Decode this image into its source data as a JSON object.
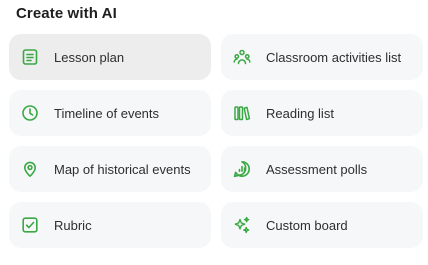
{
  "header": {
    "title": "Create with AI"
  },
  "accent_color": "#3aa845",
  "cards": [
    {
      "label": "Lesson plan",
      "icon": "document-lines-icon",
      "selected": true
    },
    {
      "label": "Classroom activities list",
      "icon": "people-group-icon",
      "selected": false
    },
    {
      "label": "Timeline of events",
      "icon": "clock-icon",
      "selected": false
    },
    {
      "label": "Reading list",
      "icon": "books-icon",
      "selected": false
    },
    {
      "label": "Map of historical events",
      "icon": "map-pin-icon",
      "selected": false
    },
    {
      "label": "Assessment polls",
      "icon": "poll-chart-icon",
      "selected": false
    },
    {
      "label": "Rubric",
      "icon": "checkbox-icon",
      "selected": false
    },
    {
      "label": "Custom board",
      "icon": "sparkles-icon",
      "selected": false
    }
  ]
}
